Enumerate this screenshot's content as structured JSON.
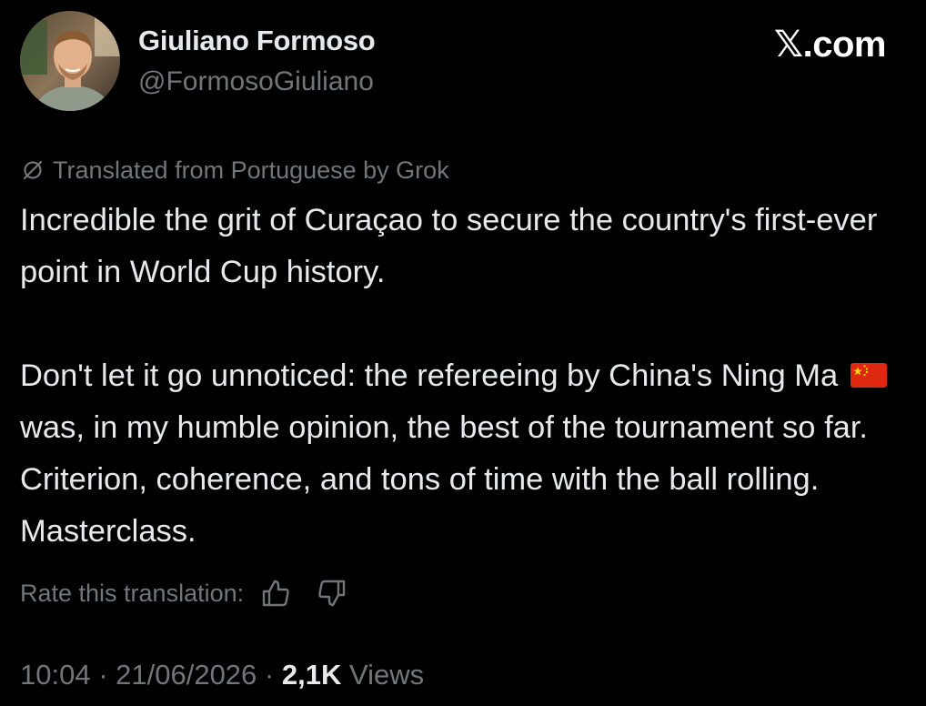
{
  "brand": "𝕏.com",
  "author": {
    "display_name": "Giuliano Formoso",
    "handle": "@FormosoGiuliano"
  },
  "translation_notice": "Translated from Portuguese by Grok",
  "tweet": {
    "paragraph_1": "Incredible the grit of Curaçao to secure the country's first-ever point in World Cup history.",
    "paragraph_2_before_flag": "Don't let it go unnoticed: the refereeing by China's Ning Ma",
    "paragraph_2_after_flag": "was, in my humble opinion, the best of the tournament so far. Criterion, coherence, and tons of time with the ball rolling. Masterclass."
  },
  "rate_label": "Rate this translation:",
  "meta": {
    "time": "10:04",
    "separator_1": " · ",
    "date": "21/06/2026",
    "separator_2": " · ",
    "views_count": "2,1K",
    "views_label": " Views"
  },
  "icons": {
    "translate": "translate-icon",
    "flag": "china-flag-icon",
    "thumbs_up": "thumbs-up-icon",
    "thumbs_down": "thumbs-down-icon"
  },
  "colors": {
    "background": "#000000",
    "primary_text": "#e7e9ea",
    "secondary_text": "#71767b",
    "flag_red": "#de2910",
    "flag_yellow": "#ffde00"
  }
}
